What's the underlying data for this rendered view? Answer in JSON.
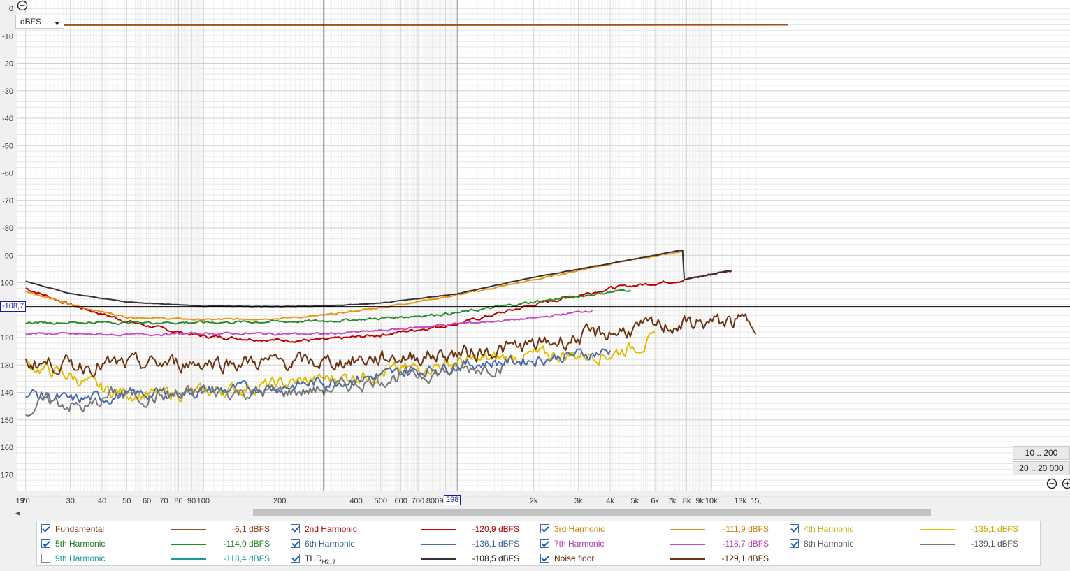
{
  "unit_selector": {
    "label": "dBFS"
  },
  "cursor": {
    "y_label": "-108,7",
    "x_label": "298"
  },
  "buttons": {
    "range_low": "10 .. 200",
    "range_full": "20 .. 20 000"
  },
  "chart_data": {
    "type": "line",
    "xscale": "log",
    "xlim": [
      19,
      15000
    ],
    "ylim": [
      -178,
      2
    ],
    "grid": true,
    "x_ticks": [
      {
        "v": 19,
        "l": "19"
      },
      {
        "v": 20,
        "l": "20"
      },
      {
        "v": 30,
        "l": "30"
      },
      {
        "v": 40,
        "l": "40"
      },
      {
        "v": 50,
        "l": "50"
      },
      {
        "v": 60,
        "l": "60"
      },
      {
        "v": 70,
        "l": "70"
      },
      {
        "v": 80,
        "l": "80"
      },
      {
        "v": 90,
        "l": "90"
      },
      {
        "v": 100,
        "l": "100"
      },
      {
        "v": 200,
        "l": "200"
      },
      {
        "v": 298,
        "l": "298"
      },
      {
        "v": 400,
        "l": "400"
      },
      {
        "v": 500,
        "l": "500"
      },
      {
        "v": 600,
        "l": "600"
      },
      {
        "v": 700,
        "l": "700"
      },
      {
        "v": 800,
        "l": "800"
      },
      {
        "v": 900,
        "l": "900"
      },
      {
        "v": 1000,
        "l": "1k"
      },
      {
        "v": 2000,
        "l": "2k"
      },
      {
        "v": 3000,
        "l": "3k"
      },
      {
        "v": 4000,
        "l": "4k"
      },
      {
        "v": 5000,
        "l": "5k"
      },
      {
        "v": 6000,
        "l": "6k"
      },
      {
        "v": 7000,
        "l": "7k"
      },
      {
        "v": 8000,
        "l": "8k"
      },
      {
        "v": 9000,
        "l": "9k"
      },
      {
        "v": 10000,
        "l": "10k"
      },
      {
        "v": 13000,
        "l": "13k"
      },
      {
        "v": 15000,
        "l": "15,"
      }
    ],
    "y_ticks": [
      {
        "v": 0,
        "l": "0"
      },
      {
        "v": -10,
        "l": "-10"
      },
      {
        "v": -20,
        "l": "-20"
      },
      {
        "v": -30,
        "l": "-30"
      },
      {
        "v": -40,
        "l": "-40"
      },
      {
        "v": -50,
        "l": "-50"
      },
      {
        "v": -60,
        "l": "-60"
      },
      {
        "v": -70,
        "l": "-70"
      },
      {
        "v": -80,
        "l": "-80"
      },
      {
        "v": -90,
        "l": "-90"
      },
      {
        "v": -100,
        "l": "100"
      },
      {
        "v": -120,
        "l": "120"
      },
      {
        "v": -130,
        "l": "130"
      },
      {
        "v": -140,
        "l": "140"
      },
      {
        "v": -150,
        "l": "150"
      },
      {
        "v": -160,
        "l": "160"
      },
      {
        "v": -170,
        "l": "170"
      }
    ],
    "series": [
      {
        "name": "Fundamental",
        "color": "#a0521e",
        "visible": true,
        "noise": 0,
        "points": [
          [
            20,
            -6.1
          ],
          [
            1000,
            -6.1
          ],
          [
            20000,
            -6.0
          ]
        ]
      },
      {
        "name": "2nd Harmonic",
        "color": "#c00000",
        "visible": true,
        "noise": 0.6,
        "points": [
          [
            20,
            -102
          ],
          [
            30,
            -108
          ],
          [
            50,
            -114
          ],
          [
            70,
            -117
          ],
          [
            100,
            -119.5
          ],
          [
            200,
            -121
          ],
          [
            300,
            -120.9
          ],
          [
            500,
            -119
          ],
          [
            1000,
            -115
          ],
          [
            2000,
            -108
          ],
          [
            4000,
            -102
          ],
          [
            8000,
            -98.8
          ],
          [
            12000,
            -95.5
          ]
        ]
      },
      {
        "name": "3rd Harmonic",
        "color": "#e8920f",
        "visible": true,
        "noise": 0.3,
        "points": [
          [
            20,
            -103
          ],
          [
            30,
            -108
          ],
          [
            50,
            -112.5
          ],
          [
            100,
            -113.5
          ],
          [
            200,
            -113
          ],
          [
            300,
            -111.9
          ],
          [
            500,
            -109
          ],
          [
            1000,
            -104.5
          ],
          [
            2000,
            -99
          ],
          [
            4000,
            -93
          ],
          [
            7800,
            -88.5
          ]
        ]
      },
      {
        "name": "4th Harmonic",
        "color": "#e2bd00",
        "visible": true,
        "noise": 2.5,
        "points": [
          [
            20,
            -130
          ],
          [
            30,
            -134
          ],
          [
            40,
            -139
          ],
          [
            60,
            -141
          ],
          [
            100,
            -140
          ],
          [
            200,
            -137
          ],
          [
            300,
            -135.1
          ],
          [
            500,
            -133
          ],
          [
            1000,
            -129
          ],
          [
            2000,
            -126.5
          ],
          [
            4000,
            -126
          ],
          [
            5000,
            -123
          ],
          [
            6000,
            -121
          ]
        ]
      },
      {
        "name": "5th Harmonic",
        "color": "#2a8a2a",
        "visible": true,
        "noise": 0.5,
        "points": [
          [
            20,
            -114.5
          ],
          [
            50,
            -114.5
          ],
          [
            100,
            -114.5
          ],
          [
            300,
            -114
          ],
          [
            500,
            -113
          ],
          [
            1000,
            -111
          ],
          [
            2000,
            -107
          ],
          [
            4800,
            -102.5
          ]
        ]
      },
      {
        "name": "6th Harmonic",
        "color": "#4a6aaa",
        "visible": true,
        "noise": 2.2,
        "points": [
          [
            20,
            -140
          ],
          [
            30,
            -143
          ],
          [
            50,
            -141
          ],
          [
            100,
            -139.5
          ],
          [
            200,
            -138
          ],
          [
            300,
            -136.1
          ],
          [
            500,
            -134
          ],
          [
            1000,
            -130
          ],
          [
            2000,
            -128
          ],
          [
            4000,
            -125
          ]
        ]
      },
      {
        "name": "7th Harmonic",
        "color": "#c34cc3",
        "visible": true,
        "noise": 0.4,
        "points": [
          [
            20,
            -118.5
          ],
          [
            50,
            -119
          ],
          [
            100,
            -118.5
          ],
          [
            300,
            -118.7
          ],
          [
            500,
            -117.5
          ],
          [
            1000,
            -115
          ],
          [
            2000,
            -113
          ],
          [
            3400,
            -110
          ]
        ]
      },
      {
        "name": "8th Harmonic",
        "color": "#777777",
        "visible": true,
        "noise": 2.6,
        "points": [
          [
            20,
            -147
          ],
          [
            25,
            -143
          ],
          [
            35,
            -146
          ],
          [
            45,
            -140
          ],
          [
            60,
            -142
          ],
          [
            100,
            -140
          ],
          [
            200,
            -140
          ],
          [
            300,
            -139.1
          ],
          [
            500,
            -135
          ],
          [
            1000,
            -132
          ],
          [
            1500,
            -130
          ]
        ]
      },
      {
        "name": "9th Harmonic",
        "color": "#1a9a9a",
        "visible": false,
        "noise": 0,
        "points": [
          [
            20,
            -118.4
          ],
          [
            1000,
            -118.4
          ]
        ]
      },
      {
        "name": "THD",
        "color": "#333333",
        "visible": true,
        "noise": 0.1,
        "points": [
          [
            20,
            -99.5
          ],
          [
            30,
            -104
          ],
          [
            50,
            -107
          ],
          [
            100,
            -108.5
          ],
          [
            200,
            -108.7
          ],
          [
            300,
            -108.5
          ],
          [
            500,
            -107.5
          ],
          [
            1000,
            -104
          ],
          [
            2000,
            -98
          ],
          [
            4000,
            -93
          ],
          [
            7800,
            -88
          ],
          [
            7800,
            -98.8
          ],
          [
            12000,
            -95.5
          ]
        ]
      },
      {
        "name": "Noise floor",
        "color": "#6b3410",
        "visible": true,
        "noise": 3,
        "points": [
          [
            20,
            -129
          ],
          [
            30,
            -130
          ],
          [
            50,
            -130
          ],
          [
            100,
            -129
          ],
          [
            200,
            -129
          ],
          [
            300,
            -129.1
          ],
          [
            500,
            -127.5
          ],
          [
            1000,
            -126
          ],
          [
            2000,
            -123
          ],
          [
            3000,
            -120
          ],
          [
            5000,
            -117
          ],
          [
            8000,
            -115
          ],
          [
            15000,
            -114
          ]
        ]
      }
    ]
  },
  "legend": [
    {
      "name": "Fundamental",
      "sub": "",
      "value": "-6,1 dBFS",
      "checked": true,
      "color": "#a0521e",
      "text_color": "#8a3a10"
    },
    {
      "name": "2nd Harmonic",
      "sub": "",
      "value": "-120,9 dBFS",
      "checked": true,
      "color": "#c00000",
      "text_color": "#b00000"
    },
    {
      "name": "3rd Harmonic",
      "sub": "",
      "value": "-111,9 dBFS",
      "checked": true,
      "color": "#e8920f",
      "text_color": "#d07f00"
    },
    {
      "name": "4th Harmonic",
      "sub": "",
      "value": "-135,1 dBFS",
      "checked": true,
      "color": "#e2bd00",
      "text_color": "#c9a800"
    },
    {
      "name": "5th Harmonic",
      "sub": "",
      "value": "-114,0 dBFS",
      "checked": true,
      "color": "#2a8a2a",
      "text_color": "#1f7a1f"
    },
    {
      "name": "6th Harmonic",
      "sub": "",
      "value": "-136,1 dBFS",
      "checked": true,
      "color": "#4a6aaa",
      "text_color": "#3a5a9a"
    },
    {
      "name": "7th Harmonic",
      "sub": "",
      "value": "-118,7 dBFS",
      "checked": true,
      "color": "#c34cc3",
      "text_color": "#b03cb0"
    },
    {
      "name": "8th Harmonic",
      "sub": "",
      "value": "-139,1 dBFS",
      "checked": true,
      "color": "#777777",
      "text_color": "#555555"
    },
    {
      "name": "9th Harmonic",
      "sub": "",
      "value": "-118,4 dBFS",
      "checked": false,
      "color": "#1a9a9a",
      "text_color": "#1a9a9a"
    },
    {
      "name": "THD",
      "sub": "H2..9",
      "value": "-108,5 dBFS",
      "checked": true,
      "color": "#333333",
      "text_color": "#222222"
    },
    {
      "name": "Noise floor",
      "sub": "",
      "value": "-129,1 dBFS",
      "checked": true,
      "color": "#6b3410",
      "text_color": "#5a2a08"
    }
  ]
}
